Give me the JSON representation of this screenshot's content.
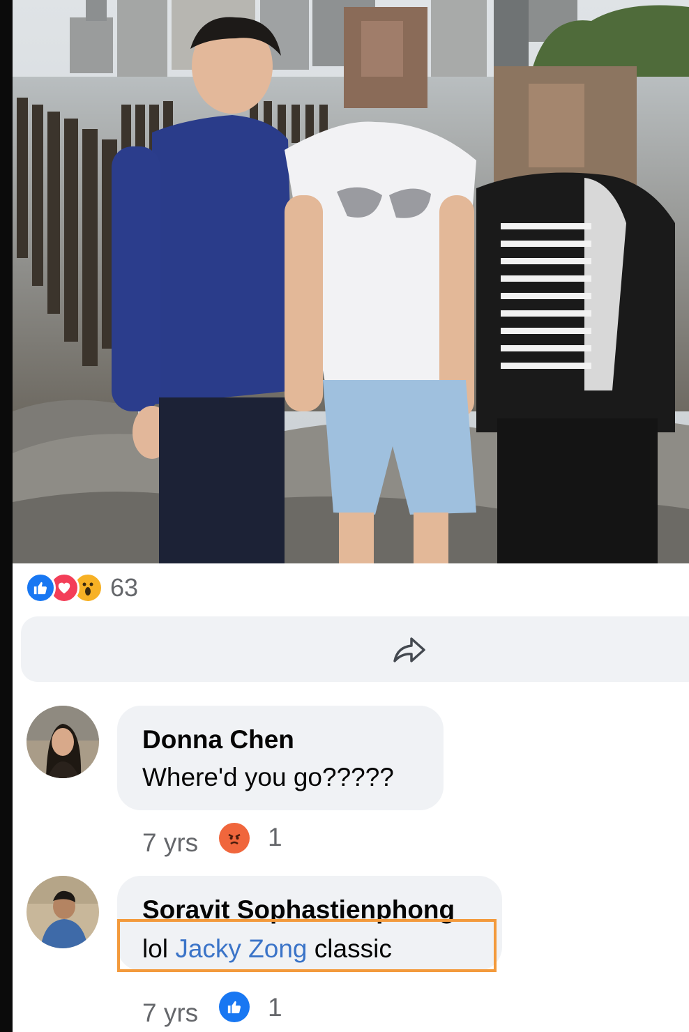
{
  "post": {
    "reactions": {
      "icons": [
        "like-icon",
        "love-icon",
        "wow-icon"
      ],
      "count": "63"
    },
    "actions": {
      "share_icon": "share-icon"
    }
  },
  "comments": [
    {
      "author": "Donna Chen",
      "text": "Where'd you go?????",
      "time": "7 yrs",
      "reaction_icon": "angry-icon",
      "reaction_count": "1"
    },
    {
      "author": "Soravit Sophastienphong",
      "text_prefix": "lol ",
      "mention": "Jacky Zong",
      "text_suffix": " classic",
      "time": "7 yrs",
      "reaction_icon": "like-icon",
      "reaction_count": "1"
    }
  ],
  "colors": {
    "like": "#1877f2",
    "love": "#f33e58",
    "wow": "#f7b125",
    "angry": "#f0663c",
    "mention": "#3b74c8",
    "bubble": "#f0f2f5",
    "highlight": "#f39a3c"
  }
}
